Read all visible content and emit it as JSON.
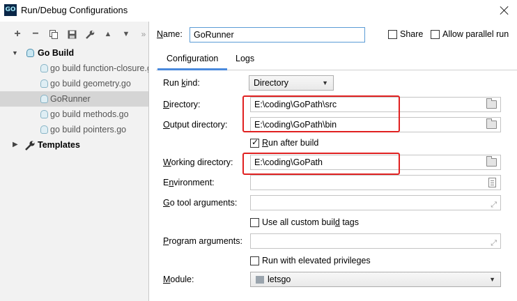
{
  "window": {
    "title": "Run/Debug Configurations",
    "app_badge": "GO"
  },
  "toolbar": {
    "add": "+",
    "remove": "−",
    "copy": "⧉",
    "save": "💾",
    "edit": "🔧",
    "up": "▲",
    "down": "▼",
    "more": "»"
  },
  "tree": {
    "go_build": "Go Build",
    "items": [
      "go build function-closure.go",
      "go build geometry.go",
      "GoRunner",
      "go build methods.go",
      "go build pointers.go"
    ],
    "selected": "GoRunner",
    "templates": "Templates"
  },
  "header": {
    "name_label": "Name:",
    "name_value": "GoRunner",
    "share_label": "Share",
    "parallel_label": "Allow parallel run",
    "share_checked": false,
    "parallel_checked": false
  },
  "tabs": [
    "Configuration",
    "Logs"
  ],
  "active_tab": "Configuration",
  "form": {
    "run_kind_label": "Run kind:",
    "run_kind_value": "Directory",
    "directory_label": "Directory:",
    "directory_value": "E:\\coding\\GoPath\\src",
    "output_label": "Output directory:",
    "output_value": "E:\\coding\\GoPath\\bin",
    "run_after_build": "Run after build",
    "run_after_build_checked": true,
    "working_label": "Working directory:",
    "working_value": "E:\\coding\\GoPath",
    "environment_label": "Environment:",
    "environment_value": "",
    "go_tool_label": "Go tool arguments:",
    "go_tool_value": "",
    "custom_tags": "Use all custom build tags",
    "custom_tags_checked": false,
    "program_args_label": "Program arguments:",
    "program_args_value": "",
    "elevated": "Run with elevated privileges",
    "elevated_checked": false,
    "module_label": "Module:",
    "module_value": "letsgo"
  },
  "colors": {
    "highlight": "#e02020",
    "tab_underline": "#4a89dc",
    "selection": "#d5d5d5"
  }
}
